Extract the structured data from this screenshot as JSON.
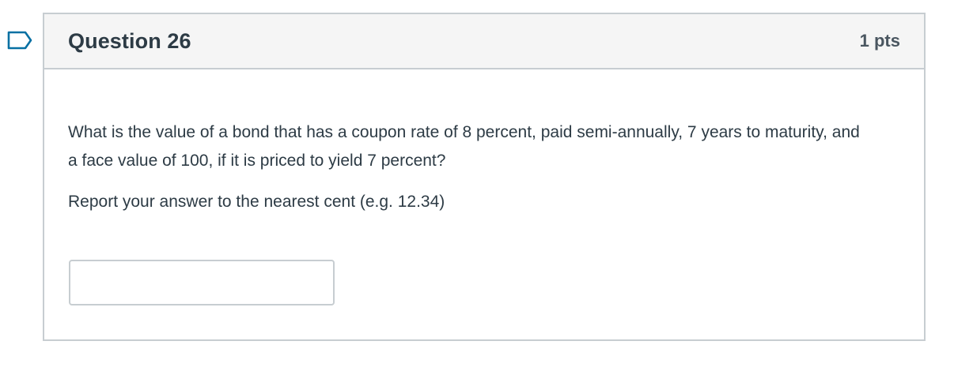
{
  "question": {
    "title": "Question 26",
    "points": "1 pts",
    "text": "What is the value of a bond that has a coupon rate of 8 percent, paid semi-annually, 7 years to maturity, and a face value of 100, if it is priced to yield 7 percent?",
    "instruction": "Report your answer to the nearest cent (e.g. 12.34)",
    "answer": {
      "value": "",
      "placeholder": ""
    }
  },
  "icons": {
    "flag": "flag-icon"
  },
  "colors": {
    "accent": "#0770a3",
    "border": "#c7cdd1",
    "header_bg": "#f5f5f5",
    "text": "#2d3b45"
  }
}
